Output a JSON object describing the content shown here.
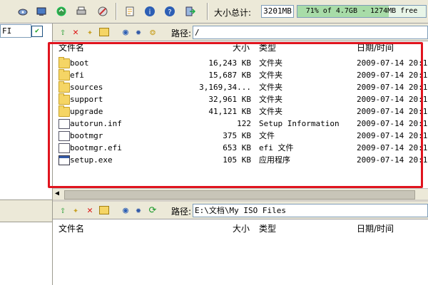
{
  "toolbar": {
    "icons": [
      "eject-icon",
      "burn-icon",
      "refresh-icon",
      "print-icon",
      "stop-icon",
      "properties-icon",
      "info-icon",
      "help-icon",
      "exit-icon"
    ],
    "size_label": "大小总计:",
    "size_value": "3201MB",
    "capacity_text": "71% of 4.7GB - 1274MB free",
    "capacity_percent": 71
  },
  "left_pane": {
    "combo_value": "FI"
  },
  "upper_pane": {
    "path_label": "路径:",
    "path_value": "/",
    "columns": {
      "name": "文件名",
      "size": "大小",
      "type": "类型",
      "date": "日期/时间"
    },
    "rows": [
      {
        "name": "boot",
        "size": "16,243 KB",
        "type": "文件夹",
        "date": "2009-07-14 20:1",
        "icon": "folder"
      },
      {
        "name": "efi",
        "size": "15,687 KB",
        "type": "文件夹",
        "date": "2009-07-14 20:1",
        "icon": "folder"
      },
      {
        "name": "sources",
        "size": "3,169,34...",
        "type": "文件夹",
        "date": "2009-07-14 20:1",
        "icon": "folder"
      },
      {
        "name": "support",
        "size": "32,961 KB",
        "type": "文件夹",
        "date": "2009-07-14 20:1",
        "icon": "folder"
      },
      {
        "name": "upgrade",
        "size": "41,121 KB",
        "type": "文件夹",
        "date": "2009-07-14 20:1",
        "icon": "folder"
      },
      {
        "name": "autorun.inf",
        "size": "122",
        "type": "Setup Information",
        "date": "2009-07-14 20:1",
        "icon": "file"
      },
      {
        "name": "bootmgr",
        "size": "375 KB",
        "type": "文件",
        "date": "2009-07-14 20:1",
        "icon": "file"
      },
      {
        "name": "bootmgr.efi",
        "size": "653 KB",
        "type": "efi 文件",
        "date": "2009-07-14 20:1",
        "icon": "file"
      },
      {
        "name": "setup.exe",
        "size": "105 KB",
        "type": "应用程序",
        "date": "2009-07-14 20:1",
        "icon": "exe"
      }
    ]
  },
  "lower_pane": {
    "path_label": "路径:",
    "path_value": "E:\\文档\\My ISO Files",
    "columns": {
      "name": "文件名",
      "size": "大小",
      "type": "类型",
      "date": "日期/时间"
    }
  },
  "colors": {
    "highlight_box": "#e0141e",
    "capacity_fill": "#a8dca8"
  }
}
